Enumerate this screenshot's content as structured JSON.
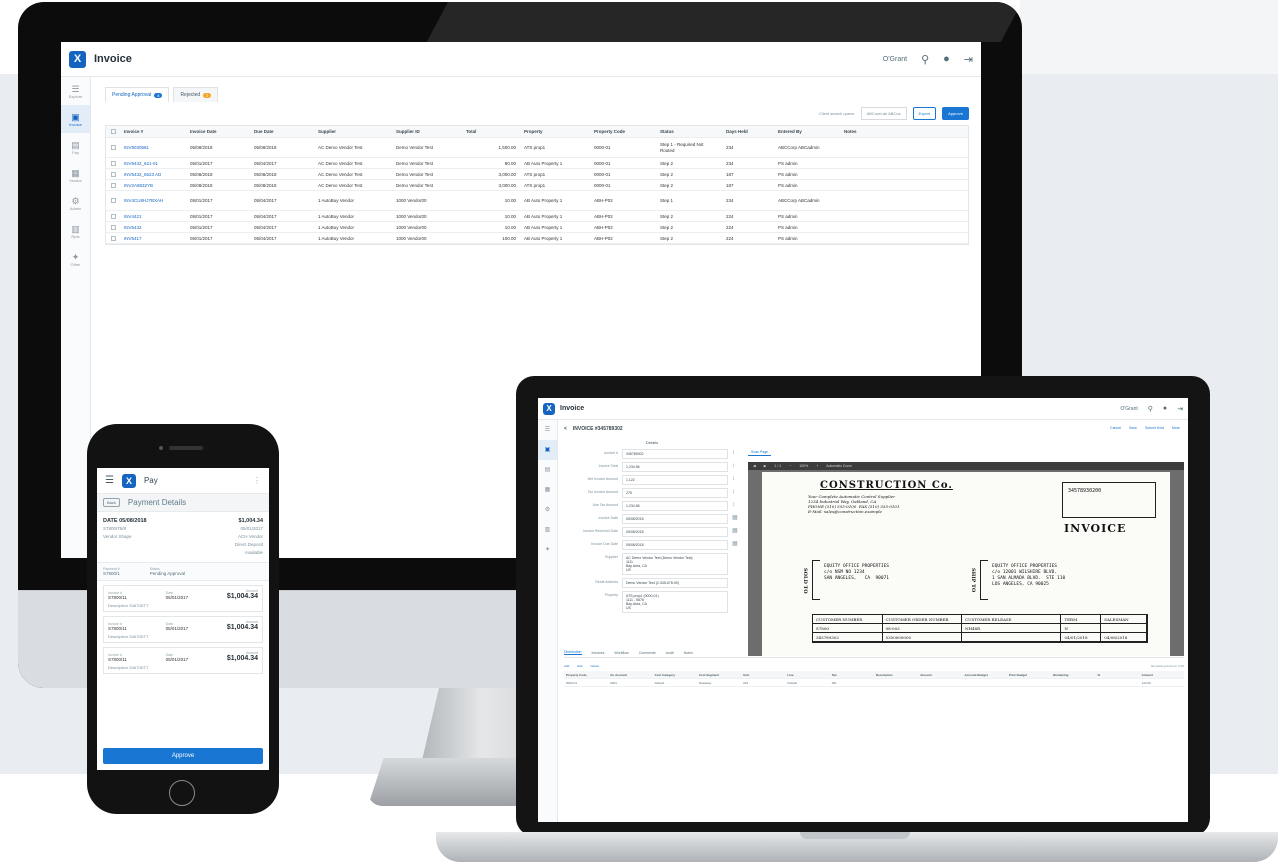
{
  "desktop": {
    "app": {
      "title": "Invoice",
      "user": "O'Grant"
    },
    "sidebar": [
      {
        "glyph": "☰",
        "label": "Explore"
      },
      {
        "glyph": "▣",
        "label": "Invoice"
      },
      {
        "glyph": "▤",
        "label": "Pay"
      },
      {
        "glyph": "▦",
        "label": "Vendor"
      },
      {
        "glyph": "⚙",
        "label": "Admin"
      },
      {
        "glyph": "▥",
        "label": "Rpts"
      },
      {
        "glyph": "✦",
        "label": "Other"
      }
    ],
    "tabs": [
      {
        "label": "Pending Approval",
        "badge": "8"
      },
      {
        "label": "Rejected",
        "badge": "2"
      }
    ],
    "toolbar": {
      "label": "Client search queue",
      "select": "ABCoreLab ABCus",
      "export": "Export",
      "approve": "Approve"
    },
    "columns": [
      "Invoice #",
      "Invoice Date",
      "Due Date",
      "Supplier",
      "Supplier ID",
      "Total",
      "Property",
      "Property Code",
      "Status",
      "Days Held",
      "Entered By",
      "Notes"
    ],
    "rows": [
      [
        "INV9030581",
        "05/08/2018",
        "05/08/2018",
        "AC Demo Vendor Test",
        "Demo Vendor Test",
        "1,500.00",
        "ATS prop1",
        "0000-01",
        "Step 1 - Required Not Routed",
        "234",
        "ABCCorp ABCadmin"
      ],
      [
        "INV9432_621-01",
        "05/01/2017",
        "05/04/2017",
        "AC Demo Vendor Test",
        "Demo Vendor Test",
        "90.00",
        "AB Auto Property 1",
        "0000-01",
        "Step 2",
        "234",
        "PS admin"
      ],
      [
        "INV5432_6523 AD",
        "05/08/2018",
        "05/08/2018",
        "AC Demo Vendor Test",
        "Demo Vendor Test",
        "3,000.00",
        "ATS prop1",
        "0000-01",
        "Step 2",
        "187",
        "PS admin"
      ],
      [
        "INV2A8832YB",
        "05/08/2018",
        "05/08/2018",
        "AC Demo Vendor Test",
        "Demo Vendor Test",
        "3,000.00",
        "ATS prop1",
        "0000-01",
        "Step 2",
        "187",
        "PS admin"
      ],
      [
        "INV4CU8HJ7BXAH",
        "05/01/2017",
        "05/04/2017",
        "1 AutoBuy Vendor",
        "1000 Vendor00",
        "10.00",
        "AB Auto Property 1",
        "ABH-P02",
        "Step 1",
        "234",
        "ABCCorp ABCadmin"
      ],
      [
        "INV4421",
        "05/01/2017",
        "05/04/2017",
        "1 AutoBuy Vendor",
        "1000 Vendor00",
        "10.00",
        "AB Auto Property 1",
        "ABH-P02",
        "Step 2",
        "224",
        "PS admin"
      ],
      [
        "INV5432",
        "05/01/2017",
        "05/04/2017",
        "1 AutoBuy Vendor",
        "1000 Vendor00",
        "10.00",
        "AB Auto Property 1",
        "ABH-P02",
        "Step 2",
        "224",
        "PS admin"
      ],
      [
        "INV5417",
        "05/01/2017",
        "05/04/2017",
        "1 AutoBuy Vendor",
        "1000 Vendor00",
        "100.00",
        "AB Auto Property 1",
        "ABH-P02",
        "Step 2",
        "224",
        "PS admin"
      ]
    ]
  },
  "laptop": {
    "app": {
      "title": "Invoice",
      "user": "O'Grant"
    },
    "crumb": {
      "back": "<",
      "title": "INVOICE #345789302"
    },
    "actions": [
      "Cancel",
      "Save",
      "Submit Hold",
      "More"
    ],
    "form": {
      "title": "Details",
      "fields": [
        {
          "label": "Invoice #",
          "value": "345789302"
        },
        {
          "label": "Invoice Total",
          "value": "1,234.56"
        },
        {
          "label": "Net Invoice Amount",
          "value": "1,122"
        },
        {
          "label": "Tax Invoice Amount",
          "value": "275"
        },
        {
          "label": "Use Tax Amount",
          "value": "1,234.56"
        },
        {
          "label": "Invoice Date",
          "value": "05/08/2018"
        },
        {
          "label": "Invoice Received Date",
          "value": "05/08/2018"
        },
        {
          "label": "Invoice Due Date",
          "value": "05/08/2018"
        },
        {
          "label": "Supplier",
          "value": "AC Demo Vendor Test (Demo Vendor Test)\n1111\nBay Area, CA\nUS"
        },
        {
          "label": "Remit Address",
          "value": "Demo Vendor Test (2-345-678-90)"
        },
        {
          "label": "Property",
          "value": "ATS prop1 (0000-01)\n1111 - 5678\nBay Area, CA\nUS"
        }
      ]
    },
    "viewer": {
      "tab": "Scan Page",
      "bar": [
        "◀",
        "▶",
        "1 / 1",
        "−",
        "100%",
        "+",
        "Automatic Zoom"
      ],
      "doc": {
        "company": "CONSTRUCTION Co.",
        "tagline": "Your Complete Automatic Control Supplier\n1234 Industrial Way, Oakland, CA\nPHONE (510) 555-0100  FAX (510) 555-0101\nE-Mail: sales@construction.example",
        "invoice": "INVOICE",
        "invoice_no": "34578930200",
        "sold_to_label": "SOLD TO",
        "ship_to_label": "SHIP TO",
        "sold_to": "EQUITY OFFICE PROPERTIES\nc/o NSM NO 1234\nSAN ANGELES,   CA  90071",
        "ship_to": "EQUITY OFFICE PROPERTIES\nc/o 12001 WILSHIRE BLVD.\n1 SAN ALMADA BLVD.  STE 110\nLOS ANGELES, CA 90025",
        "headers": [
          "CUSTOMER NUMBER",
          "CUSTOMER ORDER NUMBER",
          "CUSTOMER RELEASE",
          "TERM",
          "SALESMAN"
        ],
        "row1": [
          "S7800",
          "08-003",
          "NH48R",
          "N",
          ""
        ],
        "row2": [
          "345789302",
          "5350000000",
          "",
          "04/01/2018",
          "04/08/2018"
        ]
      }
    },
    "bottom_tabs": [
      "Distribution",
      "Invoices",
      "Workflow",
      "Comments",
      "Audit",
      "Notes"
    ],
    "grid": {
      "sub": [
        "Add",
        "Edit",
        "Delete"
      ],
      "right": "Remaining Amount: 0.00",
      "columns": [
        "Property Code",
        "GL Account",
        "Cost Category",
        "Cost Segment",
        "Unit",
        "Line",
        "Tax",
        "Description",
        "Amount",
        "Account Budget",
        "Prior Budget",
        "Remaining",
        "%",
        "Amount"
      ],
      "row": [
        "0000-01",
        "6001",
        "Default",
        "Roadway",
        "001",
        "Default",
        "001",
        "",
        "",
        "",
        "",
        "",
        "",
        "123.00"
      ]
    }
  },
  "phone": {
    "app": {
      "title": "Pay"
    },
    "header": {
      "back": "Back",
      "title": "Payment Details"
    },
    "summary": {
      "date": "DATE 05/08/2018",
      "total": "$1,004.34",
      "ref": "S7800/75/8",
      "date2": "05/01/2017",
      "vendor": "Vendor Shape",
      "bank_label": "ACH Vendor",
      "bank_note": "Direct Deposit",
      "bank_value": "Available"
    },
    "meta": {
      "pay_label": "Payment #",
      "pay_value": "S7800/1",
      "status_label": "Status",
      "status_value": "Pending Approval"
    },
    "items": [
      {
        "k1": "Invoice #",
        "v1": "S7800/11",
        "k2": "Date",
        "v2": "05/01/2017",
        "k3": "Amount",
        "v3": "$1,004.34",
        "desc": "Description  S4670DTT"
      },
      {
        "k1": "Invoice #",
        "v1": "S7800/11",
        "k2": "Date",
        "v2": "05/01/2017",
        "k3": "Amount",
        "v3": "$1,004.34",
        "desc": "Description  S4670DTT"
      },
      {
        "k1": "Invoice #",
        "v1": "S7800/11",
        "k2": "Date",
        "v2": "05/01/2017",
        "k3": "Amount",
        "v3": "$1,004.34",
        "desc": "Description  S4670DTT"
      }
    ],
    "approve_label": "Approve"
  },
  "colors": {
    "accent": "#1976d2",
    "brand": "#1565c0",
    "warning": "#f5a623"
  }
}
